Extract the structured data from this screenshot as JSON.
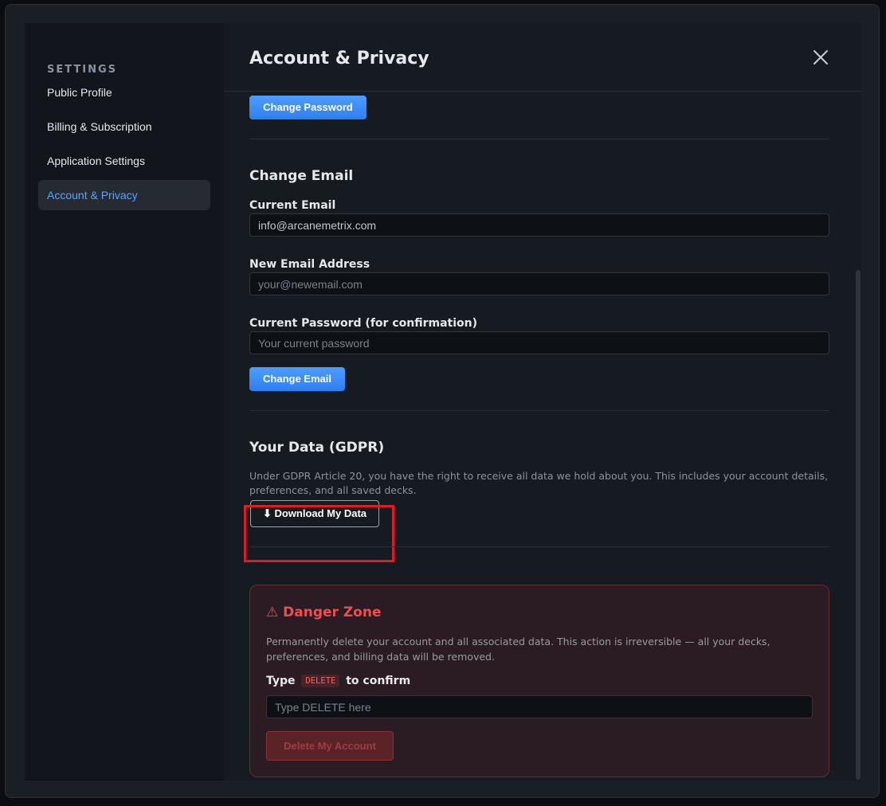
{
  "sidebar": {
    "heading": "SETTINGS",
    "items": [
      {
        "label": "Public Profile",
        "active": false
      },
      {
        "label": "Billing & Subscription",
        "active": false
      },
      {
        "label": "Application Settings",
        "active": false
      },
      {
        "label": "Account & Privacy",
        "active": true
      }
    ]
  },
  "header": {
    "title": "Account & Privacy",
    "close_icon": "close-icon"
  },
  "password_section": {
    "button_label": "Change Password"
  },
  "email_section": {
    "title": "Change Email",
    "current_email_label": "Current Email",
    "current_email_value": "info@arcanemetrix.com",
    "new_email_label": "New Email Address",
    "new_email_placeholder": "your@newemail.com",
    "password_label": "Current Password (for confirmation)",
    "password_placeholder": "Your current password",
    "button_label": "Change Email"
  },
  "gdpr_section": {
    "title": "Your Data (GDPR)",
    "description": "Under GDPR Article 20, you have the right to receive all data we hold about you. This includes your account details, preferences, and all saved decks.",
    "download_label": "⬇ Download My Data"
  },
  "danger_zone": {
    "title": "⚠ Danger Zone",
    "description": "Permanently delete your account and all associated data. This action is irreversible — all your decks, preferences, and billing data will be removed.",
    "confirm_prefix": "Type",
    "confirm_code": "DELETE",
    "confirm_suffix": "to confirm",
    "input_placeholder": "Type DELETE here",
    "delete_label": "Delete My Account"
  },
  "colors": {
    "accent": "#58a6ff",
    "primary_button": "#3b8cf7",
    "danger": "#f04e4e",
    "highlight": "#e01b24"
  }
}
